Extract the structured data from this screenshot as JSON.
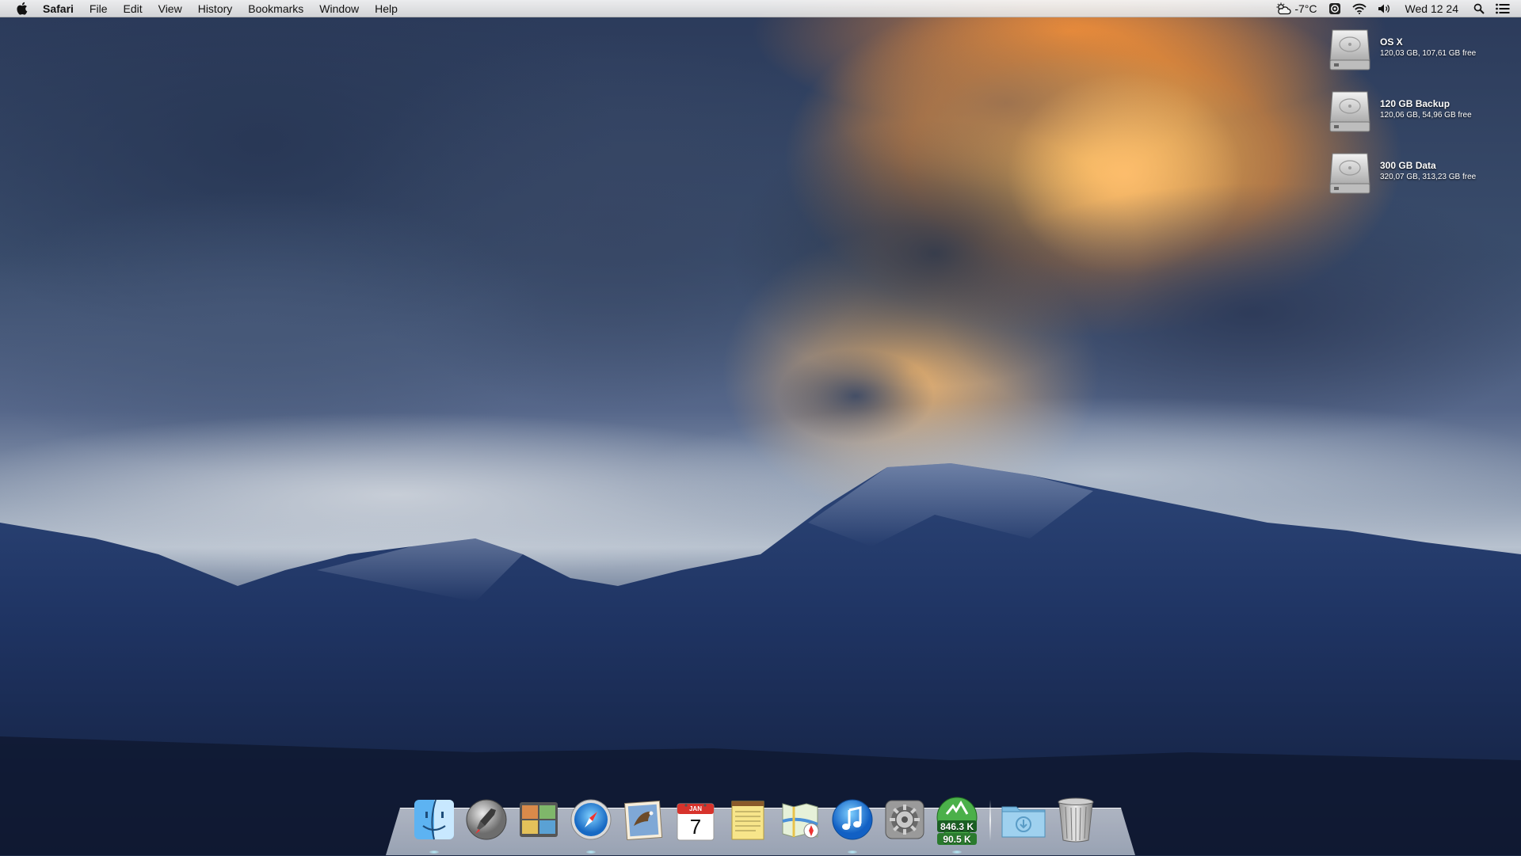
{
  "menubar": {
    "app_name": "Safari",
    "menus": [
      "File",
      "Edit",
      "View",
      "History",
      "Bookmarks",
      "Window",
      "Help"
    ],
    "status": {
      "weather_icon": "partly-cloudy-icon",
      "temperature": "-7°C",
      "clock": "Wed 12 24",
      "icons": [
        "weather-icon",
        "system-monitor-icon",
        "wifi-icon",
        "volume-icon",
        "spotlight-icon",
        "notification-center-icon"
      ]
    }
  },
  "desktop": {
    "volumes": [
      {
        "name": "OS X",
        "info": "120,03 GB, 107,61 GB free"
      },
      {
        "name": "120 GB Backup",
        "info": "120,06 GB, 54,96 GB free"
      },
      {
        "name": "300 GB Data",
        "info": "320,07 GB, 313,23 GB free"
      }
    ]
  },
  "dock": {
    "apps": [
      {
        "name": "Finder",
        "icon": "finder-icon",
        "running": true
      },
      {
        "name": "Launchpad",
        "icon": "launchpad-icon",
        "running": false
      },
      {
        "name": "Photo Booth",
        "icon": "photobooth-icon",
        "running": false
      },
      {
        "name": "Safari",
        "icon": "safari-icon",
        "running": true
      },
      {
        "name": "Mail",
        "icon": "mail-icon",
        "running": false
      },
      {
        "name": "Calendar",
        "icon": "calendar-icon",
        "running": false,
        "month": "JAN",
        "day": "7"
      },
      {
        "name": "Notes",
        "icon": "notes-icon",
        "running": false
      },
      {
        "name": "Maps",
        "icon": "maps-icon",
        "running": false
      },
      {
        "name": "iTunes",
        "icon": "itunes-icon",
        "running": true
      },
      {
        "name": "System Preferences",
        "icon": "system-preferences-icon",
        "running": false
      },
      {
        "name": "Network Monitor",
        "icon": "network-monitor-icon",
        "running": true,
        "upload": "846.3 K",
        "download": "90.5 K"
      }
    ],
    "stacks": [
      {
        "name": "Downloads",
        "icon": "downloads-folder-icon"
      },
      {
        "name": "Trash",
        "icon": "trash-icon"
      }
    ]
  },
  "colors": {
    "menubar_bg": "#ececec",
    "dock_shelf": "#d4dbe6",
    "sky_orange": "#ffb24a",
    "mountain_blue": "#1e2f55"
  }
}
